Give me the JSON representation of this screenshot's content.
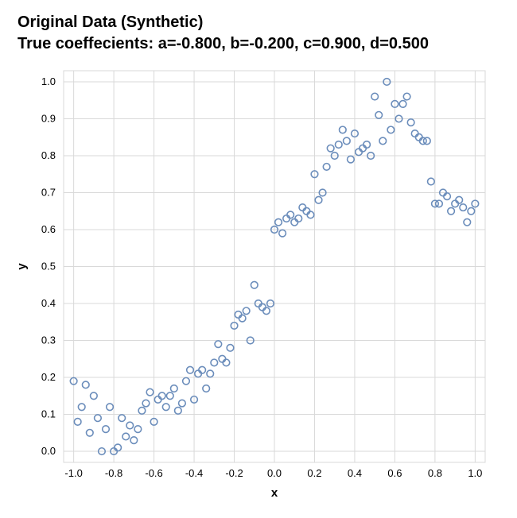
{
  "title_line1": "Original Data (Synthetic)",
  "title_line2_prefix": "True coeffecients: ",
  "coeffs_text": "a=-0.800, b=-0.200, c=0.900, d=0.500",
  "xlabel": "x",
  "ylabel": "y",
  "chart_data": {
    "type": "scatter",
    "title": "Original Data (Synthetic)",
    "subtitle": "True coeffecients: a=-0.800, b=-0.200, c=0.900, d=0.500",
    "xlabel": "x",
    "ylabel": "y",
    "xlim": [
      -1.05,
      1.05
    ],
    "ylim": [
      -0.03,
      1.03
    ],
    "xticks": [
      -1.0,
      -0.8,
      -0.6,
      -0.4,
      -0.2,
      0.0,
      0.2,
      0.4,
      0.6,
      0.8,
      1.0
    ],
    "yticks": [
      0.0,
      0.1,
      0.2,
      0.3,
      0.4,
      0.5,
      0.6,
      0.7,
      0.8,
      0.9,
      1.0
    ],
    "series": [
      {
        "name": "data",
        "x": [
          -1.0,
          -0.98,
          -0.96,
          -0.94,
          -0.92,
          -0.9,
          -0.88,
          -0.86,
          -0.84,
          -0.82,
          -0.8,
          -0.78,
          -0.76,
          -0.74,
          -0.72,
          -0.7,
          -0.68,
          -0.66,
          -0.64,
          -0.62,
          -0.6,
          -0.58,
          -0.56,
          -0.54,
          -0.52,
          -0.5,
          -0.48,
          -0.46,
          -0.44,
          -0.42,
          -0.4,
          -0.38,
          -0.36,
          -0.34,
          -0.32,
          -0.3,
          -0.28,
          -0.26,
          -0.24,
          -0.22,
          -0.2,
          -0.18,
          -0.16,
          -0.14,
          -0.12,
          -0.1,
          -0.08,
          -0.06,
          -0.04,
          -0.02,
          0.0,
          0.02,
          0.04,
          0.06,
          0.08,
          0.1,
          0.12,
          0.14,
          0.16,
          0.18,
          0.2,
          0.22,
          0.24,
          0.26,
          0.28,
          0.3,
          0.32,
          0.34,
          0.36,
          0.38,
          0.4,
          0.42,
          0.44,
          0.46,
          0.48,
          0.5,
          0.52,
          0.54,
          0.56,
          0.58,
          0.6,
          0.62,
          0.64,
          0.66,
          0.68,
          0.7,
          0.72,
          0.74,
          0.76,
          0.78,
          0.8,
          0.82,
          0.84,
          0.86,
          0.88,
          0.9,
          0.92,
          0.94,
          0.96,
          0.98,
          1.0
        ],
        "y": [
          0.19,
          0.08,
          0.12,
          0.18,
          0.05,
          0.15,
          0.09,
          0.0,
          0.06,
          0.12,
          0.0,
          0.01,
          0.09,
          0.04,
          0.07,
          0.03,
          0.06,
          0.11,
          0.13,
          0.16,
          0.08,
          0.14,
          0.15,
          0.12,
          0.15,
          0.17,
          0.11,
          0.13,
          0.19,
          0.22,
          0.14,
          0.21,
          0.22,
          0.17,
          0.21,
          0.24,
          0.29,
          0.25,
          0.24,
          0.28,
          0.34,
          0.37,
          0.36,
          0.38,
          0.3,
          0.45,
          0.4,
          0.39,
          0.38,
          0.4,
          0.6,
          0.62,
          0.59,
          0.63,
          0.64,
          0.62,
          0.63,
          0.66,
          0.65,
          0.64,
          0.75,
          0.68,
          0.7,
          0.77,
          0.82,
          0.8,
          0.83,
          0.87,
          0.84,
          0.79,
          0.86,
          0.81,
          0.82,
          0.83,
          0.8,
          0.96,
          0.91,
          0.84,
          1.0,
          0.87,
          0.94,
          0.9,
          0.94,
          0.96,
          0.89,
          0.86,
          0.85,
          0.84,
          0.84,
          0.73,
          0.67,
          0.67,
          0.7,
          0.69,
          0.65,
          0.67,
          0.68,
          0.66,
          0.62,
          0.65,
          0.67
        ]
      }
    ]
  }
}
